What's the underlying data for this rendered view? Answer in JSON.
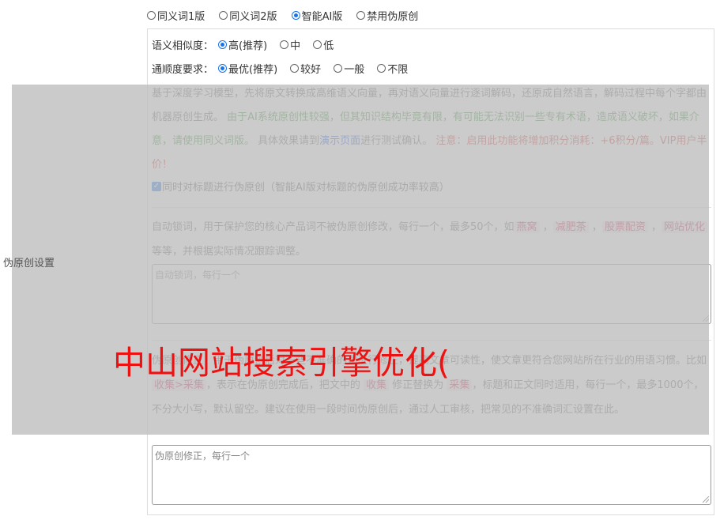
{
  "version_options": [
    {
      "label": "同义词1版",
      "selected": false
    },
    {
      "label": "同义词2版",
      "selected": false
    },
    {
      "label": "智能AI版",
      "selected": true
    },
    {
      "label": "禁用伪原创",
      "selected": false
    }
  ],
  "similarity": {
    "label": "语义相似度：",
    "options": [
      {
        "label": "高(推荐)",
        "selected": true
      },
      {
        "label": "中",
        "selected": false
      },
      {
        "label": "低",
        "selected": false
      }
    ]
  },
  "fluency": {
    "label": "通顺度要求：",
    "options": [
      {
        "label": "最优(推荐)",
        "selected": true
      },
      {
        "label": "较好",
        "selected": false
      },
      {
        "label": "一般",
        "selected": false
      },
      {
        "label": "不限",
        "selected": false
      }
    ]
  },
  "side_label": "伪原创设置",
  "description": {
    "part1": "基于深度学习模型，先将原文转换成高维语义向量，再对语义向量进行逐词解码，还原成自然语言，解码过程中每个字都由机器原创生成。",
    "part2_green": "由于AI系统原创性较强，但其知识结构毕竟有限，有可能无法识别一些专有术语，造成语义破坏，如果介意，请使用同义词版。",
    "part3": "具体效果请到",
    "link": "演示页面",
    "part4": "进行测试确认。",
    "part5_red": "注意：启用此功能将增加积分消耗：+6积分/篇。VIP用户半价！"
  },
  "title_checkbox": {
    "label": "同时对标题进行伪原创（智能AI版对标题的伪原创成功率较高）",
    "checked": true
  },
  "lock_words": {
    "text_before": "自动锁词，用于保护您的核心产品词不被伪原创修改，每行一个，最多50个，如",
    "tags": [
      "燕窝",
      "减肥茶",
      "股票配资",
      "网站优化"
    ],
    "text_after": "等等，并根据实际情况跟踪调整。",
    "placeholder": "自动锁词，每行一个"
  },
  "correction": {
    "text_a": "伪原创修正，用于伪原创后对一些不准确的词进行修正，提高文章可读性，使文章更符合您网站所在行业的用语习惯。比如",
    "tag1": "收集>采集",
    "text_b": "，表示在伪原创完成后，把文中的",
    "tag2": "收集",
    "text_c": "修正替换为",
    "tag3": "采集",
    "text_d": "，标题和正文同时适用，每行一个，最多1000个，不分大小写，默认留空。建议在使用一段时间伪原创后，通过人工审核，把常见的不准确词汇设置在此。",
    "placeholder": "伪原创修正，每行一个"
  },
  "watermark": "中山网站搜索引擎优化(",
  "colors": {
    "accent": "#1a73e8",
    "green": "#3b8a3b",
    "red": "#d03a3a",
    "link": "#1c4fd0",
    "watermark": "#ee1111"
  }
}
